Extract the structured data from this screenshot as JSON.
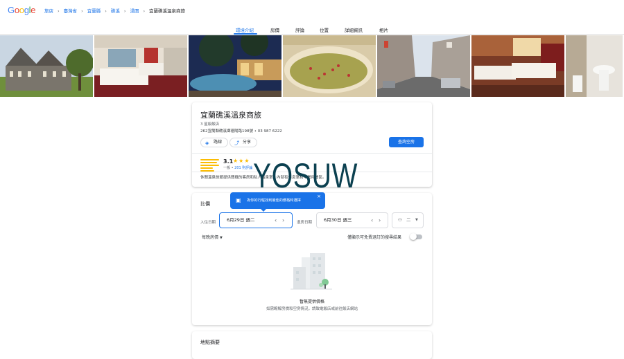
{
  "header": {
    "logo": [
      "G",
      "o",
      "o",
      "g",
      "l",
      "e"
    ],
    "breadcrumbs": [
      "旅店",
      "臺灣省",
      "宜蘭縣",
      "礁溪",
      "湯圍",
      "宜蘭礁溪溫泉商旅"
    ]
  },
  "tabs": [
    "環境介紹",
    "房價",
    "評論",
    "位置",
    "詳細資訊",
    "相片"
  ],
  "hotel": {
    "name": "宜蘭礁溪溫泉商旅",
    "class": "3 星級飯店",
    "address": "262宜蘭縣礁溪鄉德陽路198號 • 03 987 6222",
    "directions_label": "路線",
    "share_label": "分享",
    "check_rooms_label": "查詢空房",
    "rating": "3.1",
    "stars": "★★★",
    "rating_word": "一般",
    "review_count": "201 則評論",
    "description": "休閒溫泉旅館提供簡樸的客房和私人溫泉室，內部有休息室和早餐用餐區。"
  },
  "watermark": "YOSUW",
  "price": {
    "title": "比價",
    "tooltip": "為你的行程找到最佳的價格和選擇",
    "checkin_label": "入住日期",
    "checkin_value": "6月29日 週二",
    "checkout_label": "退房日期",
    "checkout_value": "6月30日 週三",
    "guests_value": "二",
    "nightly_label": "每晚房價",
    "free_cancel_label": "僅顯示可免費退訂的搜尋結果",
    "empty_title": "暫無提供價格",
    "empty_subtitle": "如需瞭解房價和空房情況，請致電飯店或前往飯店網站"
  },
  "overview": {
    "title": "地點摘要"
  }
}
